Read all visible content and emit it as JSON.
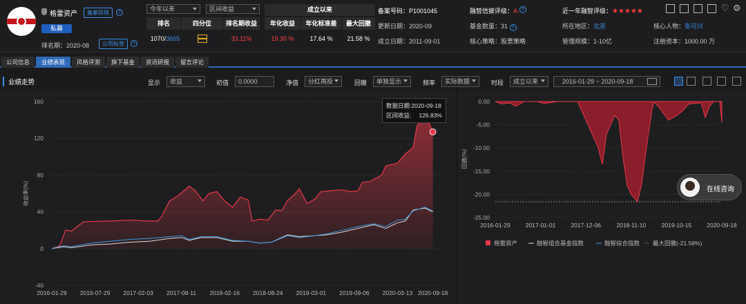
{
  "firm": {
    "name": "格雷资产",
    "tag_record": "备案存续",
    "type": "私募",
    "rank_period_label": "排名期：",
    "rank_period": "2020-08",
    "company_tag": "公司标签"
  },
  "period_select": {
    "range": "今年以来",
    "metric": "区间收益"
  },
  "stats": {
    "headers": [
      "排名",
      "四分位",
      "排名期收益",
      "年化收益",
      "年化标准差",
      "最大回撤"
    ],
    "rank": "1070/",
    "rank_total": "3665",
    "period_return": "33.11%",
    "ann_return": "19.30 %",
    "ann_std": "17.64 %",
    "max_dd": "21.58 %",
    "since_inception": "成立以来"
  },
  "info": {
    "record_no": "备案号码：P1001045",
    "update_date": "更新日期：2020-09",
    "found_date": "成立日期：2011-09-01",
    "rating_label": "融智信披评级：",
    "rating": "A-",
    "fund_count": "基金数量：31",
    "strategy": "核心策略：股票策略",
    "year_rating_label": "近一年融智评级：",
    "stars": "★★★★★",
    "region_label": "所在地区：",
    "region": "北京",
    "scale": "管理规模：1-10亿",
    "person_label": "核心人物：",
    "person": "张可兴",
    "capital": "注册资本：1000.00 万"
  },
  "tabs": [
    "公司信息",
    "业绩表现",
    "风格评测",
    "旗下基金",
    "资讯研报",
    "留言评论"
  ],
  "toolbar": {
    "section": "业绩走势",
    "show_label": "显示",
    "show_val": "收益",
    "init_label": "初值",
    "init_val": "0.0000",
    "nav_label": "净值",
    "nav_val": "分红再投",
    "dd_label": "回撤",
    "dd_val": "单独显示",
    "freq_label": "频率",
    "freq_val": "实际数据",
    "period_label": "时段",
    "period_val": "成立以来",
    "date_from": "2016-01-29",
    "date_sep": "~",
    "date_to": "2020-09-18"
  },
  "tooltip": {
    "date_label": "数据日期:",
    "date": "2020-09-18",
    "ret_label": "区间收益:",
    "ret": "126.83%"
  },
  "chat": "在线咨询",
  "colors": {
    "red": "#e8394a",
    "blue": "#3a9de6",
    "white": "#dcdcdc",
    "accent": "#2f6ab8"
  },
  "chart_data": [
    {
      "type": "area",
      "ylabel": "收益率(%)",
      "ylim": [
        -40,
        160
      ],
      "yticks": [
        -40,
        0,
        40,
        80,
        120,
        160
      ],
      "x": [
        "2016-01-29",
        "2016-07-29",
        "2017-02-03",
        "2017-08-11",
        "2018-02-16",
        "2018-08-24",
        "2019-03-01",
        "2019-09-06",
        "2020-03-13",
        "2020-09-18"
      ],
      "series": [
        {
          "name": "格雷资产",
          "color": "#e8394a",
          "points": [
            [
              0,
              0
            ],
            [
              0.2,
              3
            ],
            [
              0.35,
              20
            ],
            [
              0.5,
              19
            ],
            [
              0.8,
              29
            ],
            [
              1,
              29.5
            ],
            [
              1.5,
              30
            ],
            [
              2,
              31
            ],
            [
              2.4,
              30
            ],
            [
              2.7,
              30
            ],
            [
              2.8,
              35
            ],
            [
              3,
              52
            ],
            [
              3.2,
              57
            ],
            [
              3.5,
              68
            ],
            [
              3.65,
              63
            ],
            [
              3.85,
              52
            ],
            [
              4,
              60
            ],
            [
              4.2,
              62
            ],
            [
              4.4,
              52
            ],
            [
              4.6,
              45
            ],
            [
              4.8,
              56
            ],
            [
              5,
              53
            ],
            [
              5.1,
              30
            ],
            [
              5.3,
              32
            ],
            [
              5.5,
              31
            ],
            [
              5.7,
              42
            ],
            [
              5.85,
              41
            ],
            [
              6,
              52
            ],
            [
              6.2,
              60
            ],
            [
              6.3,
              65
            ],
            [
              6.5,
              49
            ],
            [
              6.7,
              54
            ],
            [
              6.85,
              62
            ],
            [
              7.1,
              63
            ],
            [
              7.4,
              64
            ],
            [
              7.6,
              62
            ],
            [
              7.8,
              63
            ],
            [
              7.9,
              72
            ],
            [
              8.1,
              73
            ],
            [
              8.4,
              80
            ],
            [
              8.5,
              90
            ],
            [
              8.8,
              93
            ],
            [
              9.0,
              103
            ],
            [
              9.2,
              110
            ],
            [
              9.3,
              134
            ],
            [
              9.45,
              143
            ],
            [
              9.6,
              137
            ],
            [
              9.7,
              127
            ]
          ]
        },
        {
          "name": "融智组合基金指数",
          "color": "#dcdcdc",
          "points": [
            [
              0,
              0
            ],
            [
              0.3,
              2
            ],
            [
              0.5,
              1
            ],
            [
              1,
              4
            ],
            [
              1.5,
              5
            ],
            [
              2,
              7
            ],
            [
              2.5,
              8
            ],
            [
              3,
              11
            ],
            [
              3.3,
              12
            ],
            [
              3.5,
              9
            ],
            [
              3.8,
              12
            ],
            [
              4.2,
              12
            ],
            [
              4.6,
              8
            ],
            [
              5,
              8
            ],
            [
              5.3,
              6
            ],
            [
              5.6,
              7
            ],
            [
              6,
              15
            ],
            [
              6.3,
              13
            ],
            [
              6.7,
              14
            ],
            [
              7,
              15
            ],
            [
              7.4,
              18
            ],
            [
              7.8,
              22
            ],
            [
              8.2,
              26
            ],
            [
              8.5,
              22
            ],
            [
              8.8,
              28
            ],
            [
              9.0,
              30
            ],
            [
              9.2,
              42
            ],
            [
              9.5,
              44
            ],
            [
              9.7,
              40
            ]
          ]
        },
        {
          "name": "融智综合指数",
          "color": "#3a9de6",
          "points": [
            [
              0,
              0
            ],
            [
              0.3,
              3
            ],
            [
              0.5,
              2
            ],
            [
              1,
              6
            ],
            [
              1.5,
              8
            ],
            [
              2,
              10
            ],
            [
              2.5,
              11
            ],
            [
              3,
              13
            ],
            [
              3.3,
              14
            ],
            [
              3.5,
              10
            ],
            [
              3.8,
              13
            ],
            [
              4.2,
              13
            ],
            [
              4.6,
              9
            ],
            [
              5,
              8
            ],
            [
              5.3,
              6
            ],
            [
              5.6,
              7
            ],
            [
              6,
              14
            ],
            [
              6.3,
              12
            ],
            [
              6.7,
              14
            ],
            [
              7,
              16
            ],
            [
              7.4,
              20
            ],
            [
              7.8,
              24
            ],
            [
              8.2,
              27
            ],
            [
              8.5,
              24
            ],
            [
              8.8,
              31
            ],
            [
              9.0,
              32
            ],
            [
              9.2,
              41
            ],
            [
              9.5,
              45
            ],
            [
              9.7,
              41
            ]
          ]
        }
      ]
    },
    {
      "type": "area",
      "ylabel": "回撤(%)",
      "ylim": [
        -25,
        0
      ],
      "yticks": [
        "0.00",
        "-5.00",
        "-10.00",
        "-15.00",
        "-20.00",
        "-25.00"
      ],
      "x": [
        "2016-01-29",
        "2017-01-01",
        "2017-12-06",
        "2018-11-10",
        "2019-10-15",
        "2020-09-18"
      ],
      "series": [
        {
          "name": "格雷资产",
          "color": "#e8394a",
          "points": [
            [
              0,
              0
            ],
            [
              0.15,
              -0.5
            ],
            [
              0.35,
              -0.3
            ],
            [
              0.5,
              -1
            ],
            [
              0.7,
              0
            ],
            [
              1,
              0
            ],
            [
              1.2,
              -0.4
            ],
            [
              1.5,
              0
            ],
            [
              2,
              0
            ],
            [
              2.1,
              -2
            ],
            [
              2.3,
              -6
            ],
            [
              2.5,
              -10
            ],
            [
              2.6,
              -13.5
            ],
            [
              2.7,
              -7
            ],
            [
              2.9,
              -3
            ],
            [
              3,
              -4
            ],
            [
              3.1,
              -12
            ],
            [
              3.2,
              -18
            ],
            [
              3.3,
              -20
            ],
            [
              3.45,
              -21.58
            ],
            [
              3.55,
              -18
            ],
            [
              3.7,
              -8
            ],
            [
              3.8,
              -2
            ],
            [
              3.85,
              0
            ],
            [
              4,
              -1.5
            ],
            [
              4.2,
              -4
            ],
            [
              4.4,
              -3
            ],
            [
              4.55,
              -2
            ],
            [
              4.7,
              -0.5
            ],
            [
              5,
              -0.3
            ],
            [
              5.1,
              -3.5
            ],
            [
              5.2,
              -1
            ],
            [
              5.3,
              0
            ],
            [
              5.45,
              0
            ],
            [
              5.5,
              -4.5
            ]
          ]
        }
      ],
      "legend": [
        "格雷资产",
        "融智组合基金指数",
        "融智综合指数",
        "最大回撤(-21.58%)"
      ],
      "max_drawdown": -21.58
    }
  ]
}
